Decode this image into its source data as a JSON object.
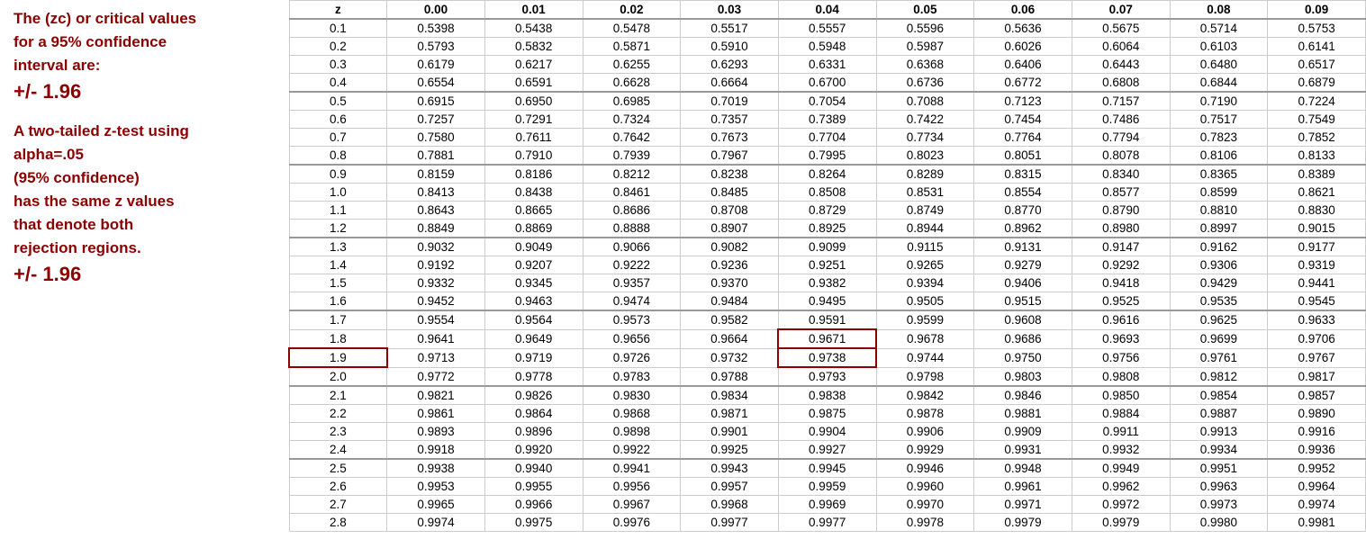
{
  "left": {
    "line1": "The (zc) or critical values",
    "line2": "for a 95% confidence",
    "line3": "interval are:",
    "line4": "+/- 1.96",
    "line5": "A two-tailed z-test using",
    "line6": "alpha=.05",
    "line7": "(95% confidence)",
    "line8": "has the same z values",
    "line9": "that denote both",
    "line10": "rejection regions.",
    "line11": "+/- 1.96"
  },
  "table": {
    "columns": [
      "z",
      "0.00",
      "0.01",
      "0.02",
      "0.03",
      "0.04",
      "0.05",
      "0.06",
      "0.07",
      "0.08",
      "0.09"
    ],
    "rows": [
      [
        "0.1",
        "0.5398",
        "0.5438",
        "0.5478",
        "0.5517",
        "0.5557",
        "0.5596",
        "0.5636",
        "0.5675",
        "0.5714",
        "0.5753"
      ],
      [
        "0.2",
        "0.5793",
        "0.5832",
        "0.5871",
        "0.5910",
        "0.5948",
        "0.5987",
        "0.6026",
        "0.6064",
        "0.6103",
        "0.6141"
      ],
      [
        "0.3",
        "0.6179",
        "0.6217",
        "0.6255",
        "0.6293",
        "0.6331",
        "0.6368",
        "0.6406",
        "0.6443",
        "0.6480",
        "0.6517"
      ],
      [
        "0.4",
        "0.6554",
        "0.6591",
        "0.6628",
        "0.6664",
        "0.6700",
        "0.6736",
        "0.6772",
        "0.6808",
        "0.6844",
        "0.6879"
      ],
      [
        "0.5",
        "0.6915",
        "0.6950",
        "0.6985",
        "0.7019",
        "0.7054",
        "0.7088",
        "0.7123",
        "0.7157",
        "0.7190",
        "0.7224"
      ],
      [
        "0.6",
        "0.7257",
        "0.7291",
        "0.7324",
        "0.7357",
        "0.7389",
        "0.7422",
        "0.7454",
        "0.7486",
        "0.7517",
        "0.7549"
      ],
      [
        "0.7",
        "0.7580",
        "0.7611",
        "0.7642",
        "0.7673",
        "0.7704",
        "0.7734",
        "0.7764",
        "0.7794",
        "0.7823",
        "0.7852"
      ],
      [
        "0.8",
        "0.7881",
        "0.7910",
        "0.7939",
        "0.7967",
        "0.7995",
        "0.8023",
        "0.8051",
        "0.8078",
        "0.8106",
        "0.8133"
      ],
      [
        "0.9",
        "0.8159",
        "0.8186",
        "0.8212",
        "0.8238",
        "0.8264",
        "0.8289",
        "0.8315",
        "0.8340",
        "0.8365",
        "0.8389"
      ],
      [
        "1.0",
        "0.8413",
        "0.8438",
        "0.8461",
        "0.8485",
        "0.8508",
        "0.8531",
        "0.8554",
        "0.8577",
        "0.8599",
        "0.8621"
      ],
      [
        "1.1",
        "0.8643",
        "0.8665",
        "0.8686",
        "0.8708",
        "0.8729",
        "0.8749",
        "0.8770",
        "0.8790",
        "0.8810",
        "0.8830"
      ],
      [
        "1.2",
        "0.8849",
        "0.8869",
        "0.8888",
        "0.8907",
        "0.8925",
        "0.8944",
        "0.8962",
        "0.8980",
        "0.8997",
        "0.9015"
      ],
      [
        "1.3",
        "0.9032",
        "0.9049",
        "0.9066",
        "0.9082",
        "0.9099",
        "0.9115",
        "0.9131",
        "0.9147",
        "0.9162",
        "0.9177"
      ],
      [
        "1.4",
        "0.9192",
        "0.9207",
        "0.9222",
        "0.9236",
        "0.9251",
        "0.9265",
        "0.9279",
        "0.9292",
        "0.9306",
        "0.9319"
      ],
      [
        "1.5",
        "0.9332",
        "0.9345",
        "0.9357",
        "0.9370",
        "0.9382",
        "0.9394",
        "0.9406",
        "0.9418",
        "0.9429",
        "0.9441"
      ],
      [
        "1.6",
        "0.9452",
        "0.9463",
        "0.9474",
        "0.9484",
        "0.9495",
        "0.9505",
        "0.9515",
        "0.9525",
        "0.9535",
        "0.9545"
      ],
      [
        "1.7",
        "0.9554",
        "0.9564",
        "0.9573",
        "0.9582",
        "0.9591",
        "0.9599",
        "0.9608",
        "0.9616",
        "0.9625",
        "0.9633"
      ],
      [
        "1.8",
        "0.9641",
        "0.9649",
        "0.9656",
        "0.9664",
        "0.9671",
        "0.9678",
        "0.9686",
        "0.9693",
        "0.9699",
        "0.9706"
      ],
      [
        "1.9",
        "0.9713",
        "0.9719",
        "0.9726",
        "0.9732",
        "0.9738",
        "0.9744",
        "0.9750",
        "0.9756",
        "0.9761",
        "0.9767"
      ],
      [
        "2.0",
        "0.9772",
        "0.9778",
        "0.9783",
        "0.9788",
        "0.9793",
        "0.9798",
        "0.9803",
        "0.9808",
        "0.9812",
        "0.9817"
      ],
      [
        "2.1",
        "0.9821",
        "0.9826",
        "0.9830",
        "0.9834",
        "0.9838",
        "0.9842",
        "0.9846",
        "0.9850",
        "0.9854",
        "0.9857"
      ],
      [
        "2.2",
        "0.9861",
        "0.9864",
        "0.9868",
        "0.9871",
        "0.9875",
        "0.9878",
        "0.9881",
        "0.9884",
        "0.9887",
        "0.9890"
      ],
      [
        "2.3",
        "0.9893",
        "0.9896",
        "0.9898",
        "0.9901",
        "0.9904",
        "0.9906",
        "0.9909",
        "0.9911",
        "0.9913",
        "0.9916"
      ],
      [
        "2.4",
        "0.9918",
        "0.9920",
        "0.9922",
        "0.9925",
        "0.9927",
        "0.9929",
        "0.9931",
        "0.9932",
        "0.9934",
        "0.9936"
      ],
      [
        "2.5",
        "0.9938",
        "0.9940",
        "0.9941",
        "0.9943",
        "0.9945",
        "0.9946",
        "0.9948",
        "0.9949",
        "0.9951",
        "0.9952"
      ],
      [
        "2.6",
        "0.9953",
        "0.9955",
        "0.9956",
        "0.9957",
        "0.9959",
        "0.9960",
        "0.9961",
        "0.9962",
        "0.9963",
        "0.9964"
      ],
      [
        "2.7",
        "0.9965",
        "0.9966",
        "0.9967",
        "0.9968",
        "0.9969",
        "0.9970",
        "0.9971",
        "0.9972",
        "0.9973",
        "0.9974"
      ],
      [
        "2.8",
        "0.9974",
        "0.9975",
        "0.9976",
        "0.9977",
        "0.9977",
        "0.9978",
        "0.9979",
        "0.9979",
        "0.9980",
        "0.9981"
      ]
    ],
    "highlight_row_index": 18,
    "highlight_cell_row": 18,
    "highlight_cell_col": 6,
    "highlight_prev_row": 17,
    "highlight_prev_col": 6
  }
}
